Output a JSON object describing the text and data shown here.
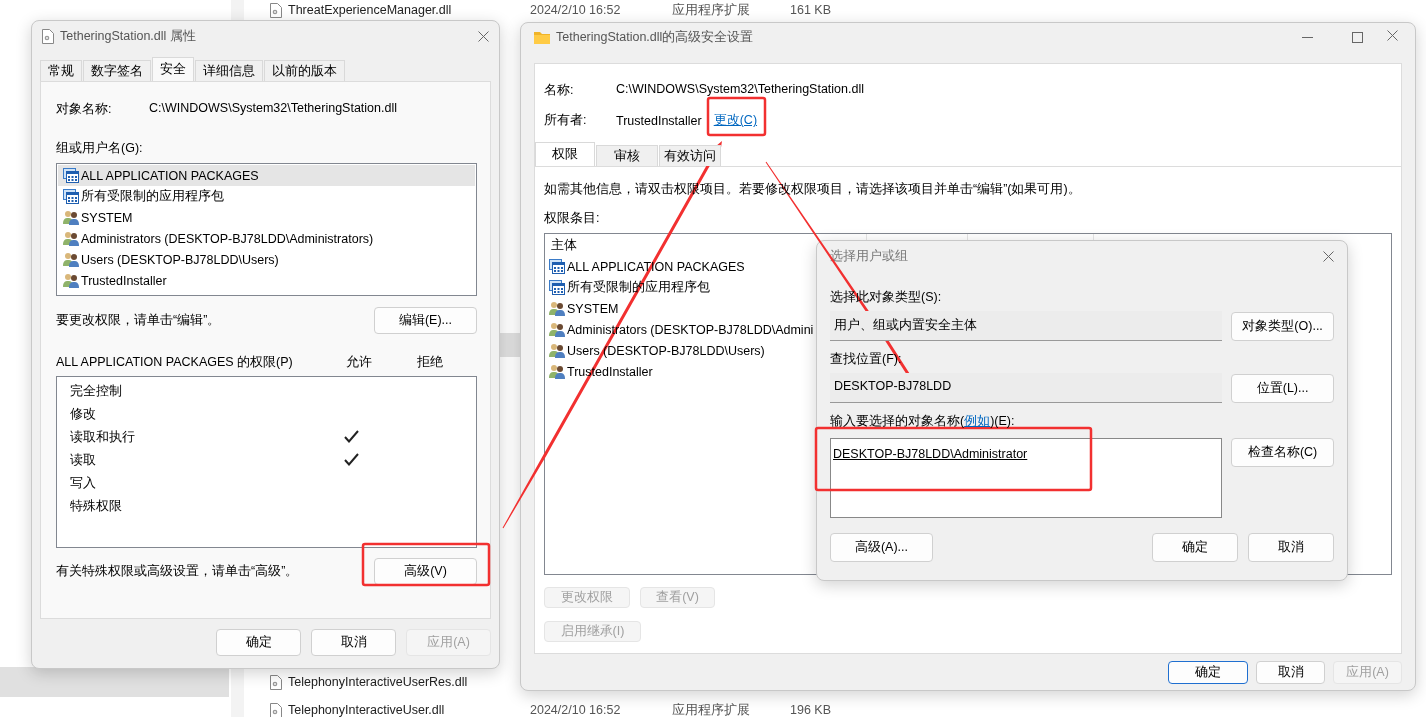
{
  "explorer": {
    "files": [
      {
        "name": "ThreatExperienceManager.dll",
        "date": "2024/2/10 16:52",
        "type": "应用程序扩展",
        "size": "161 KB"
      },
      {
        "name": "TelephonyInteractiveUserRes.dll"
      },
      {
        "name": "TelephonyInteractiveUser.dll",
        "date": "2024/2/10 16:52",
        "type": "应用程序扩展",
        "size": "196 KB"
      }
    ]
  },
  "properties_window": {
    "title": "TetheringStation.dll 属性",
    "tabs": [
      {
        "label": "常规",
        "selected": false
      },
      {
        "label": "数字签名",
        "selected": false
      },
      {
        "label": "安全",
        "selected": true
      },
      {
        "label": "详细信息",
        "selected": false
      },
      {
        "label": "以前的版本",
        "selected": false
      }
    ],
    "object_name_label": "对象名称:",
    "object_name": "C:\\WINDOWS\\System32\\TetheringStation.dll",
    "groups_label": "组或用户名(G):",
    "groups": [
      {
        "name": "ALL APPLICATION PACKAGES",
        "kind": "package",
        "selected": true
      },
      {
        "name": "所有受限制的应用程序包",
        "kind": "package",
        "selected": false
      },
      {
        "name": "SYSTEM",
        "kind": "users",
        "selected": false
      },
      {
        "name": "Administrators (DESKTOP-BJ78LDD\\Administrators)",
        "kind": "users",
        "selected": false
      },
      {
        "name": "Users (DESKTOP-BJ78LDD\\Users)",
        "kind": "users",
        "selected": false
      },
      {
        "name": "TrustedInstaller",
        "kind": "users",
        "selected": false
      }
    ],
    "edit_hint": "要更改权限，请单击“编辑”。",
    "edit_button": "编辑(E)...",
    "permissions_label": "ALL APPLICATION PACKAGES 的权限(P)",
    "allow_header": "允许",
    "deny_header": "拒绝",
    "permissions": [
      {
        "name": "完全控制",
        "allow": false,
        "deny": false
      },
      {
        "name": "修改",
        "allow": false,
        "deny": false
      },
      {
        "name": "读取和执行",
        "allow": true,
        "deny": false
      },
      {
        "name": "读取",
        "allow": true,
        "deny": false
      },
      {
        "name": "写入",
        "allow": false,
        "deny": false
      },
      {
        "name": "特殊权限",
        "allow": false,
        "deny": false
      }
    ],
    "advanced_hint": "有关特殊权限或高级设置，请单击“高级”。",
    "advanced_button": "高级(V)",
    "buttons": [
      {
        "label": "确定",
        "disabled": false
      },
      {
        "label": "取消",
        "disabled": false
      },
      {
        "label": "应用(A)",
        "disabled": true
      }
    ]
  },
  "advanced_window": {
    "title": "TetheringStation.dll的高级安全设置",
    "name_label": "名称:",
    "name": "C:\\WINDOWS\\System32\\TetheringStation.dll",
    "owner_label": "所有者:",
    "owner": "TrustedInstaller",
    "change_link": "更改(C)",
    "tabs": [
      {
        "label": "权限",
        "selected": true
      },
      {
        "label": "审核",
        "selected": false
      },
      {
        "label": "有效访问",
        "selected": false
      }
    ],
    "info": "如需其他信息，请双击权限项目。若要修改权限项目，请选择该项目并单击“编辑”(如果可用)。",
    "entries_label": "权限条目:",
    "principal_header": "主体",
    "entries": [
      {
        "name": "ALL APPLICATION PACKAGES",
        "kind": "package"
      },
      {
        "name": "所有受限制的应用程序包",
        "kind": "package"
      },
      {
        "name": "SYSTEM",
        "kind": "users"
      },
      {
        "name": "Administrators (DESKTOP-BJ78LDD\\Admini",
        "kind": "users"
      },
      {
        "name": "Users (DESKTOP-BJ78LDD\\Users)",
        "kind": "users"
      },
      {
        "name": "TrustedInstaller",
        "kind": "users"
      }
    ],
    "entry_buttons": [
      {
        "label": "更改权限",
        "disabled": true
      },
      {
        "label": "查看(V)",
        "disabled": true
      }
    ],
    "inherit_button": {
      "label": "启用继承(I)",
      "disabled": true
    },
    "buttons": [
      {
        "label": "确定",
        "default": true,
        "disabled": false
      },
      {
        "label": "取消",
        "default": false,
        "disabled": false
      },
      {
        "label": "应用(A)",
        "default": false,
        "disabled": true
      }
    ]
  },
  "select_dialog": {
    "title": "选择用户或组",
    "type_label": "选择此对象类型(S):",
    "type_value": "用户、组或内置安全主体",
    "type_button": "对象类型(O)...",
    "location_label": "查找位置(F):",
    "location_value": "DESKTOP-BJ78LDD",
    "location_button": "位置(L)...",
    "names_label_before": "输入要选择的对象名称(",
    "names_label_link": "例如",
    "names_label_after": ")(E):",
    "names_value": "DESKTOP-BJ78LDD\\Administrator",
    "check_button": "检查名称(C)",
    "advanced_button": "高级(A)...",
    "ok_button": "确定",
    "cancel_button": "取消"
  }
}
